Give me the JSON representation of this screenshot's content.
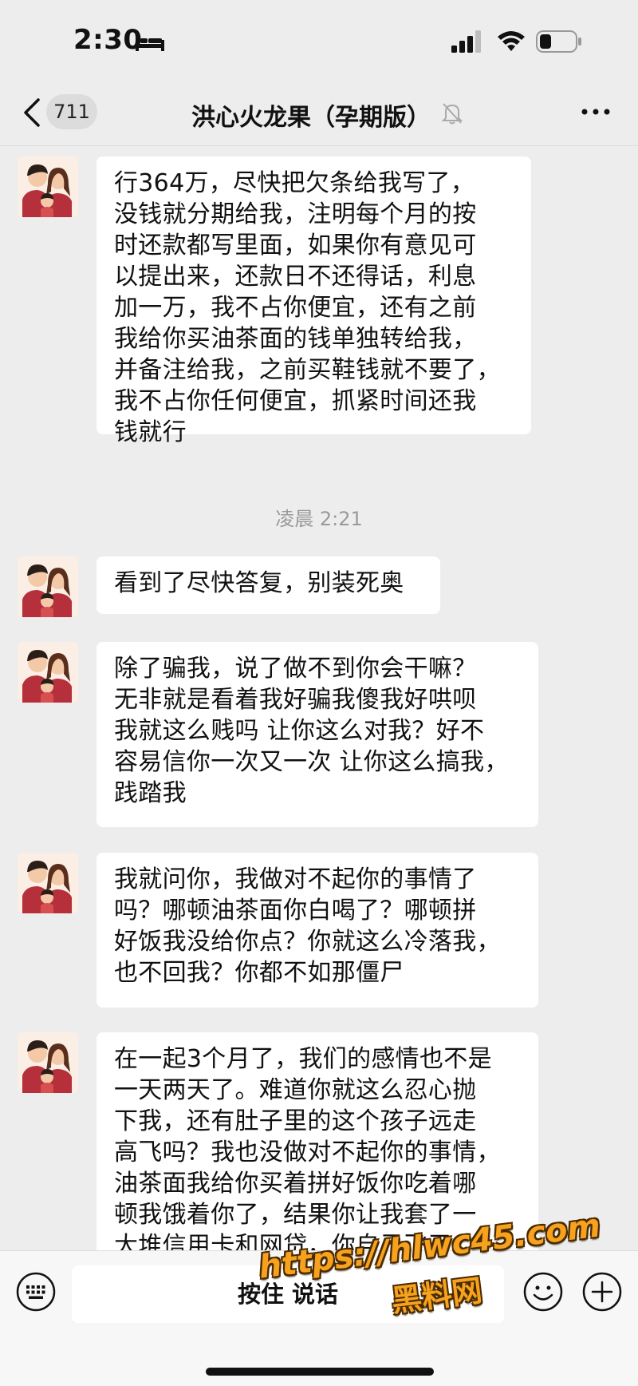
{
  "status_bar": {
    "time": "2:30"
  },
  "nav": {
    "unread_count": "711",
    "title": "洪心火龙果（孕期版）"
  },
  "messages": [
    {
      "lines": [
        "行364万，尽快把欠条给我写了，",
        "没钱就分期给我，注明每个月的按",
        "时还款都写里面，如果你有意见可",
        "以提出来，还款日不还得话，利息",
        "加一万，我不占你便宜，还有之前",
        "我给你买油茶面的钱单独转给我，",
        "并备注给我，之前买鞋钱就不要了，",
        "我不占你任何便宜，抓紧时间还我",
        "钱就行"
      ]
    },
    {
      "lines": [
        "看到了尽快答复，别装死奥"
      ]
    },
    {
      "lines": [
        "除了骗我，说了做不到你会干嘛？",
        "无非就是看着我好骗我傻我好哄呗",
        "我就这么贱吗 让你这么对我？好不",
        "容易信你一次又一次 让你这么搞我，",
        "践踏我"
      ]
    },
    {
      "lines": [
        "我就问你，我做对不起你的事情了",
        "吗？哪顿油茶面你白喝了？哪顿拼",
        "好饭我没给你点？你就这么冷落我，",
        "也不回我？你都不如那僵尸"
      ]
    },
    {
      "lines": [
        "在一起3个月了，我们的感情也不是",
        "一天两天了。难道你就这么忍心抛",
        "下我，还有肚子里的这个孩子远走",
        "高飞吗？我也没做对不起你的事情，",
        "油茶面我给你买着拼好饭你吃着哪",
        "顿我饿着你了，结果你让我套了一",
        "大堆信用卡和网贷，你自己飞了"
      ]
    }
  ],
  "timestamp": "凌晨 2:21",
  "input_bar": {
    "hold_to_talk": "按住 说话"
  },
  "watermark": {
    "url": "https://hlwc45.com",
    "name": "黑料网"
  },
  "colors": {
    "background": "#ededed",
    "bubble": "#ffffff",
    "watermark": "#f6a21e"
  },
  "icons": [
    "back-icon",
    "mute-bell-icon",
    "more-icon",
    "keyboard-icon",
    "emoji-icon",
    "add-icon",
    "signal-icon",
    "wifi-icon",
    "battery-icon",
    "bed-icon"
  ]
}
